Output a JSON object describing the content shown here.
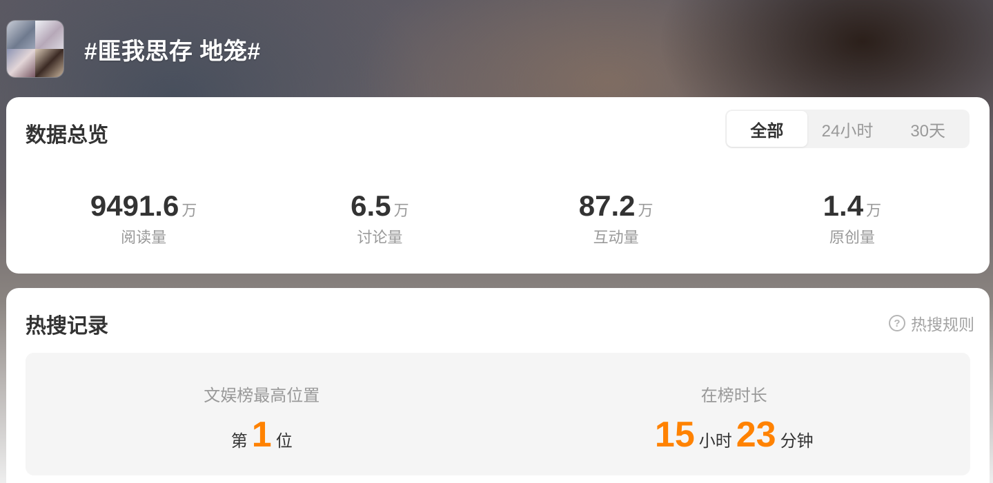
{
  "header": {
    "topic": "#匪我思存 地笼#",
    "avatar_icon": "topic-collage-avatar"
  },
  "overview": {
    "title": "数据总览",
    "tabs": [
      {
        "label": "全部",
        "active": true
      },
      {
        "label": "24小时",
        "active": false
      },
      {
        "label": "30天",
        "active": false
      }
    ],
    "stats": [
      {
        "value": "9491.6",
        "unit": "万",
        "label": "阅读量"
      },
      {
        "value": "6.5",
        "unit": "万",
        "label": "讨论量"
      },
      {
        "value": "87.2",
        "unit": "万",
        "label": "互动量"
      },
      {
        "value": "1.4",
        "unit": "万",
        "label": "原创量"
      }
    ]
  },
  "hot_search": {
    "title": "热搜记录",
    "rules_label": "热搜规则",
    "rules_icon": "question-circle-icon",
    "highest": {
      "label": "文娱榜最高位置",
      "prefix": "第",
      "rank": "1",
      "suffix": "位"
    },
    "duration": {
      "label": "在榜时长",
      "hours": "15",
      "hours_unit": "小时",
      "minutes": "23",
      "minutes_unit": "分钟"
    }
  },
  "colors": {
    "accent": "#ff8200",
    "text_primary": "#333333",
    "text_secondary": "#999999",
    "card_bg": "#ffffff",
    "panel_bg": "#f5f5f5"
  }
}
